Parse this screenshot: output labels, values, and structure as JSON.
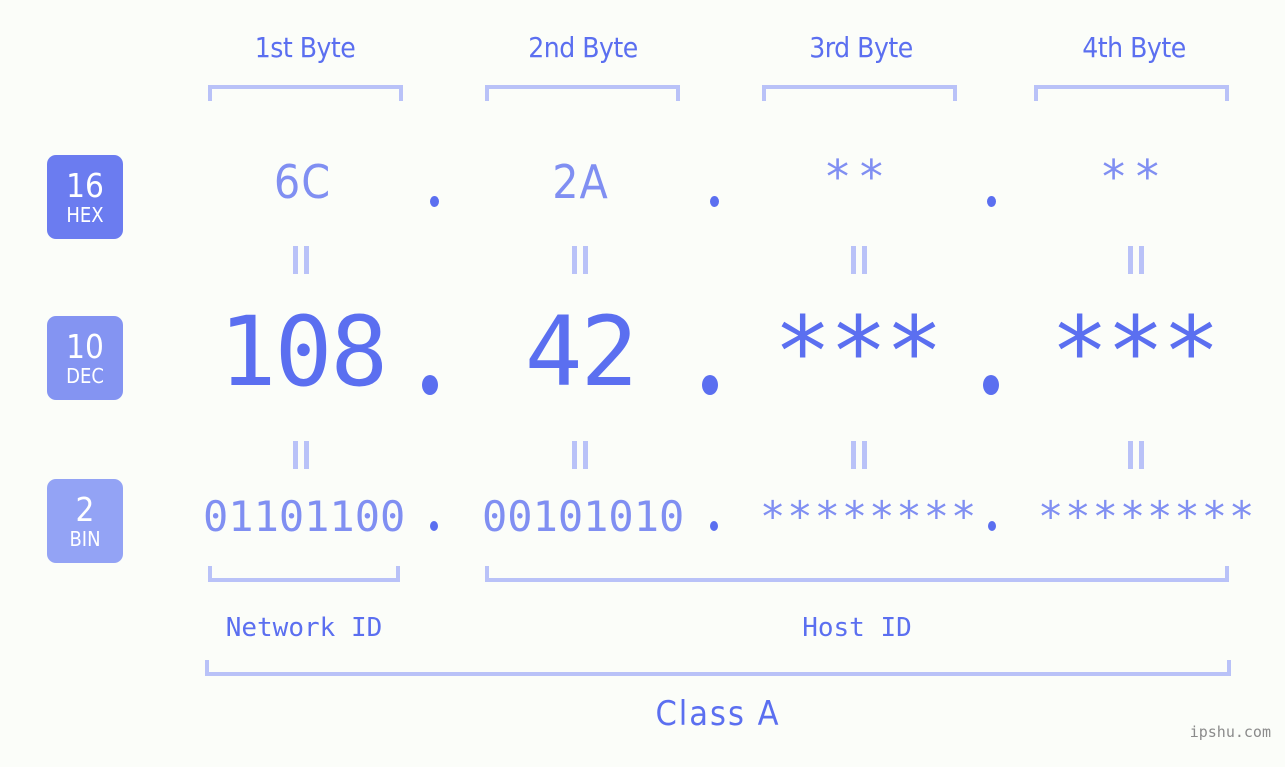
{
  "meta": {
    "background_color": "#fbfdf9",
    "accent_color": "#5b6ff0",
    "accent_light_color": "#808ff2",
    "bracket_color": "#b9c2f8",
    "watermark": "ipshu.com"
  },
  "header": {
    "byte_labels": [
      "1st Byte",
      "2nd Byte",
      "3rd Byte",
      "4th Byte"
    ]
  },
  "bases": [
    {
      "num": "16",
      "name": "HEX",
      "color": "#6b7cf0"
    },
    {
      "num": "10",
      "name": "DEC",
      "color": "#8494f2"
    },
    {
      "num": "2",
      "name": "BIN",
      "color": "#93a3f5"
    }
  ],
  "rows": {
    "hex": {
      "values": [
        "6C",
        "2A",
        "**",
        "**"
      ],
      "separator": "."
    },
    "dec": {
      "values": [
        "108",
        "42",
        "***",
        "***"
      ],
      "separator": "."
    },
    "bin": {
      "values": [
        "01101100",
        "00101010",
        "********",
        "********"
      ],
      "separator": "."
    }
  },
  "equal_marks": {
    "symbol": "||",
    "rows": [
      "hex-to-dec",
      "dec-to-bin"
    ]
  },
  "footer": {
    "network_id_label": "Network ID",
    "host_id_label": "Host ID",
    "class_label": "Class A"
  }
}
